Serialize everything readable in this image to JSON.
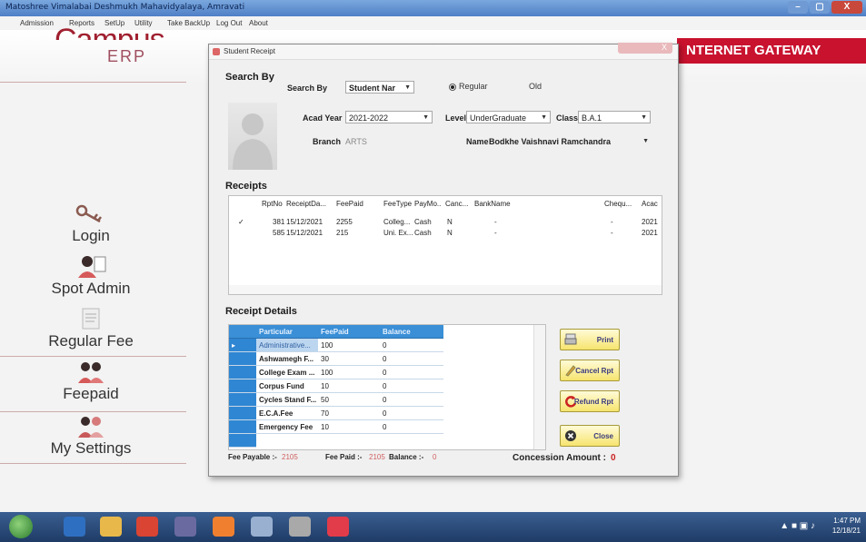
{
  "window": {
    "title": "Matoshree Vimalabai Deshmukh Mahavidyalaya, Amravati",
    "controls": {
      "min": "–",
      "max": "▢",
      "close": "X"
    }
  },
  "menu": [
    "Admission",
    "Reports",
    "SetUp",
    "Utility",
    "Take BackUp",
    "Log Out",
    "About"
  ],
  "branding": {
    "campus": "Campus",
    "erp": "ERP",
    "gateway": "NTERNET GATEWAY"
  },
  "sidebar": {
    "items": [
      {
        "label": "Login",
        "icon": "key-icon"
      },
      {
        "label": "Spot Admin",
        "icon": "user-icon"
      },
      {
        "label": "Regular Fee",
        "icon": "document-icon"
      },
      {
        "label": "Feepaid",
        "icon": "users-icon"
      },
      {
        "label": "My Settings",
        "icon": "users-icon"
      }
    ]
  },
  "dialog": {
    "title": "Student Receipt",
    "close_label": "X",
    "search_by_heading": "Search By",
    "search_by_label": "Search By",
    "search_by_value": "Student Nar",
    "radio_regular": "Regular",
    "radio_old": "Old",
    "acad_year_label": "Acad Year",
    "acad_year_value": "2021-2022",
    "level_label": "Level",
    "level_value": "UnderGraduate",
    "class_label": "Class",
    "class_value": "B.A.1",
    "branch_label": "Branch",
    "branch_value": "ARTS",
    "name_label": "Name",
    "name_value": "Bodkhe Vaishnavi Ramchandra",
    "receipts_heading": "Receipts",
    "receipts_columns": [
      "RptNo",
      "ReceiptDa...",
      "FeePaid",
      "FeeType",
      "PayMo...",
      "Canc...",
      "BankName",
      "Chequ...",
      "Acac"
    ],
    "receipts_rows": [
      {
        "check": "✓",
        "rpt": "381",
        "date": "15/12/2021",
        "fee": "2255",
        "type": "Colleg...",
        "mode": "Cash",
        "canc": "N",
        "bank": "-",
        "cheq": "-",
        "acad": "2021"
      },
      {
        "check": "",
        "rpt": "585",
        "date": "15/12/2021",
        "fee": "215",
        "type": "Uni. Ex...",
        "mode": "Cash",
        "canc": "N",
        "bank": "-",
        "cheq": "-",
        "acad": "2021"
      }
    ],
    "receipt_details_heading": "Receipt Details",
    "details_columns": [
      "Particular",
      "FeePaid",
      "Balance"
    ],
    "details_rows": [
      {
        "particular": "Administrative...",
        "paid": "100",
        "balance": "0"
      },
      {
        "particular": "Ashwamegh F...",
        "paid": "30",
        "balance": "0"
      },
      {
        "particular": "College Exam ...",
        "paid": "100",
        "balance": "0"
      },
      {
        "particular": "Corpus Fund",
        "paid": "10",
        "balance": "0"
      },
      {
        "particular": "Cycles Stand F...",
        "paid": "50",
        "balance": "0"
      },
      {
        "particular": "E.C.A.Fee",
        "paid": "70",
        "balance": "0"
      },
      {
        "particular": "Emergency Fee",
        "paid": "10",
        "balance": "0"
      }
    ],
    "buttons": {
      "print": "Print",
      "cancel": "Cancel Rpt",
      "refund": "Refund Rpt",
      "close": "Close"
    },
    "fee_payable_label": "Fee Payable :-",
    "fee_payable_value": "2105",
    "fee_paid_label": "Fee Paid :-",
    "fee_paid_value": "2105",
    "balance_label": "Balance :-",
    "balance_value": "0",
    "concession_label": "Concession Amount :",
    "concession_value": "0"
  },
  "taskbar": {
    "time": "1:47 PM",
    "date": "12/18/21"
  }
}
